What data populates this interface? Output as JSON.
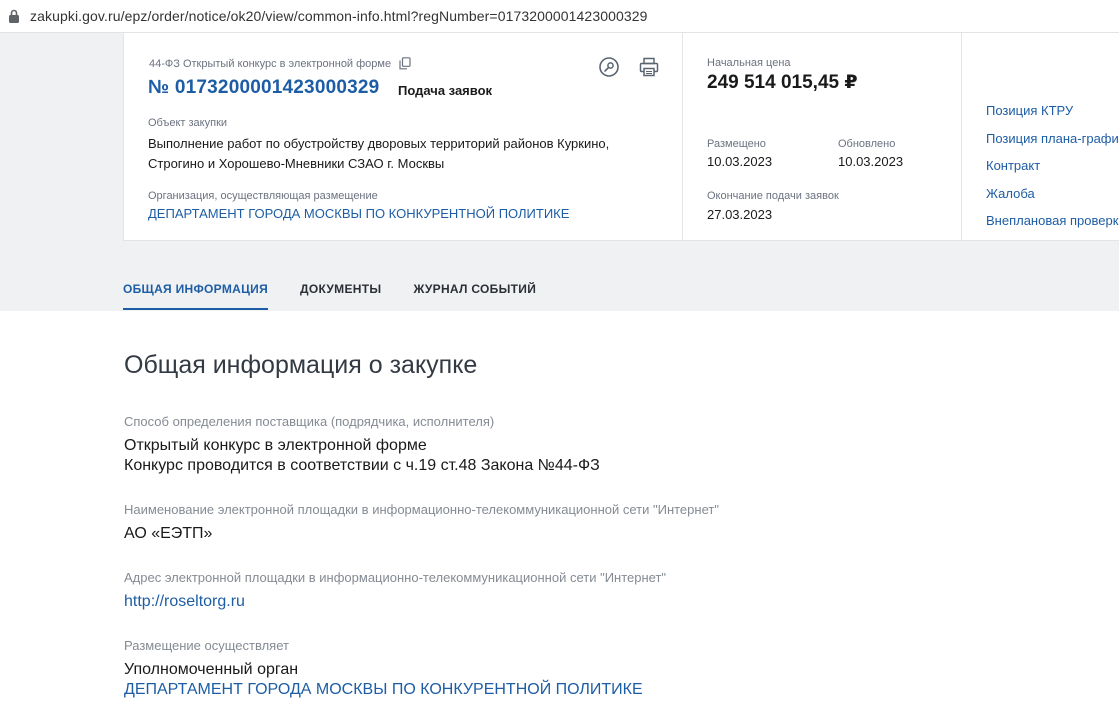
{
  "browser": {
    "url": "zakupki.gov.ru/epz/order/notice/ok20/view/common-info.html?regNumber=0173200001423000329"
  },
  "header": {
    "law_type": "44-ФЗ Открытый конкурс в электронной форме",
    "reg_number": "№ 0173200001423000329",
    "status": "Подача заявок",
    "object_label": "Объект закупки",
    "object_value": "Выполнение работ по обустройству дворовых территорий районов Куркино, Строгино и Хорошево-Мневники СЗАО г. Москвы",
    "org_label": "Организация, осуществляющая размещение",
    "org_value": "ДЕПАРТАМЕНТ ГОРОДА МОСКВЫ ПО КОНКУРЕНТНОЙ ПОЛИТИКЕ",
    "price_label": "Начальная цена",
    "price_value": "249 514 015,45 ₽",
    "posted_label": "Размещено",
    "posted_value": "10.03.2023",
    "updated_label": "Обновлено",
    "updated_value": "10.03.2023",
    "deadline_label": "Окончание подачи заявок",
    "deadline_value": "27.03.2023",
    "side_links": [
      "Позиция КТРУ",
      "Позиция плана-графика",
      "Контракт",
      "Жалоба",
      "Внеплановая проверка"
    ]
  },
  "tabs": [
    "ОБЩАЯ ИНФОРМАЦИЯ",
    "ДОКУМЕНТЫ",
    "ЖУРНАЛ СОБЫТИЙ"
  ],
  "main": {
    "title": "Общая информация о закупке",
    "fields": [
      {
        "label": "Способ определения поставщика (подрядчика, исполнителя)",
        "lines": [
          "Открытый конкурс в электронной форме",
          "Конкурс проводится в соответствии с ч.19 ст.48 Закона №44-ФЗ"
        ]
      },
      {
        "label": "Наименование электронной площадки в информационно-телекоммуникационной сети \"Интернет\"",
        "lines": [
          "АО «ЕЭТП»"
        ]
      },
      {
        "label": "Адрес электронной площадки в информационно-телекоммуникационной сети \"Интернет\"",
        "link": "http://roseltorg.ru"
      },
      {
        "label": "Размещение осуществляет",
        "lines": [
          "Уполномоченный орган"
        ],
        "link": "ДЕПАРТАМЕНТ ГОРОДА МОСКВЫ ПО КОНКУРЕНТНОЙ ПОЛИТИКЕ"
      }
    ]
  },
  "colors": {
    "link": "#1d5da6",
    "band": "#eff1f3"
  },
  "icons": [
    "lock-icon",
    "copy-icon",
    "search-icon",
    "print-icon"
  ]
}
